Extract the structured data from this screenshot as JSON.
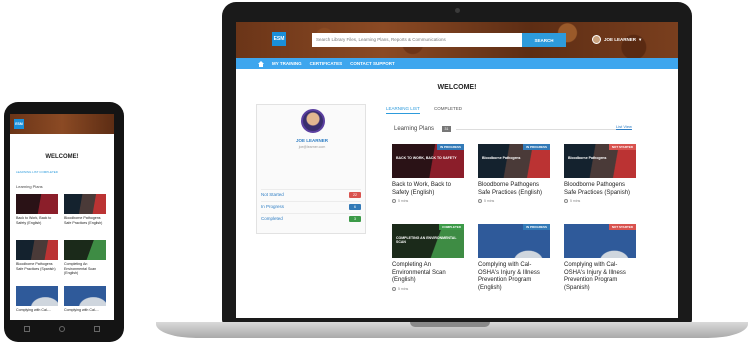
{
  "laptop": {
    "logo_text": "ESM",
    "search_placeholder": "Search Library Files, Learning Plans, Reports & Communications",
    "search_button": "SEARCH",
    "user_name": "JOE LEARNER",
    "nav": [
      "MY TRAINING",
      "CERTIFICATES",
      "CONTACT SUPPORT"
    ],
    "welcome": "WELCOME!",
    "profile": {
      "name": "JOE LEARNER",
      "email": "joe@learner.com",
      "rows": [
        {
          "label": "Not Started",
          "count": "22",
          "color": "#d9534f"
        },
        {
          "label": "In Progress",
          "count": "6",
          "color": "#337ab7"
        },
        {
          "label": "Completed",
          "count": "3",
          "color": "#3c9a48"
        }
      ]
    },
    "tabs": [
      "LEARNING LIST",
      "COMPLETED"
    ],
    "learning_plans_label": "Learning Plans",
    "learning_plans_count": "31",
    "list_view": "List View",
    "cards": [
      {
        "title": "Back to Work, Back to Safety (English)",
        "status": "IN PROGRESS",
        "status_color": "#337ab7",
        "thumb_text": "BACK TO WORK, BACK TO SAFETY",
        "meta": "5 mins",
        "thumb": "t-red"
      },
      {
        "title": "Bloodborne Pathogens Safe Practices (English)",
        "status": "IN PROGRESS",
        "status_color": "#337ab7",
        "thumb_text": "Bloodborne Pathogens",
        "meta": "5 mins",
        "thumb": "t-dark"
      },
      {
        "title": "Bloodborne Pathogens Safe Practices (Spanish)",
        "status": "NOT STARTED",
        "status_color": "#d9534f",
        "thumb_text": "Bloodborne Pathogens",
        "meta": "5 mins",
        "thumb": "t-dark"
      },
      {
        "title": "Completing An Environmental Scan (English)",
        "status": "COMPLETED",
        "status_color": "#3c9a48",
        "thumb_text": "COMPLETING AN ENVIRONMENTAL SCAN",
        "meta": "5 mins",
        "thumb": "t-green"
      },
      {
        "title": "Complying with Cal-OSHA's Injury & Illness Prevention Program (English)",
        "status": "IN PROGRESS",
        "status_color": "#337ab7",
        "thumb_text": "",
        "meta": "",
        "thumb": "t-dome"
      },
      {
        "title": "Complying with Cal-OSHA's Injury & Illness Prevention Program (Spanish)",
        "status": "NOT STARTED",
        "status_color": "#d9534f",
        "thumb_text": "",
        "meta": "",
        "thumb": "t-dome"
      }
    ]
  },
  "phone": {
    "logo_text": "ESM",
    "welcome": "WELCOME!",
    "tabs": "LEARNING LIST     COMPLETED",
    "learning_plans_label": "Learning Plans",
    "cards": [
      {
        "title": "Back to Work, Back to Safety (English)",
        "thumb": "t-red"
      },
      {
        "title": "Bloodborne Pathogens Safe Practices (English)",
        "thumb": "t-dark"
      },
      {
        "title": "Bloodborne Pathogens Safe Practices (Spanish)",
        "thumb": "t-dark"
      },
      {
        "title": "Completing An Environmental Scan (English)",
        "thumb": "t-green"
      },
      {
        "title": "Complying with Cal-...",
        "thumb": "t-dome"
      },
      {
        "title": "Complying with Cal-...",
        "thumb": "t-dome"
      }
    ]
  }
}
